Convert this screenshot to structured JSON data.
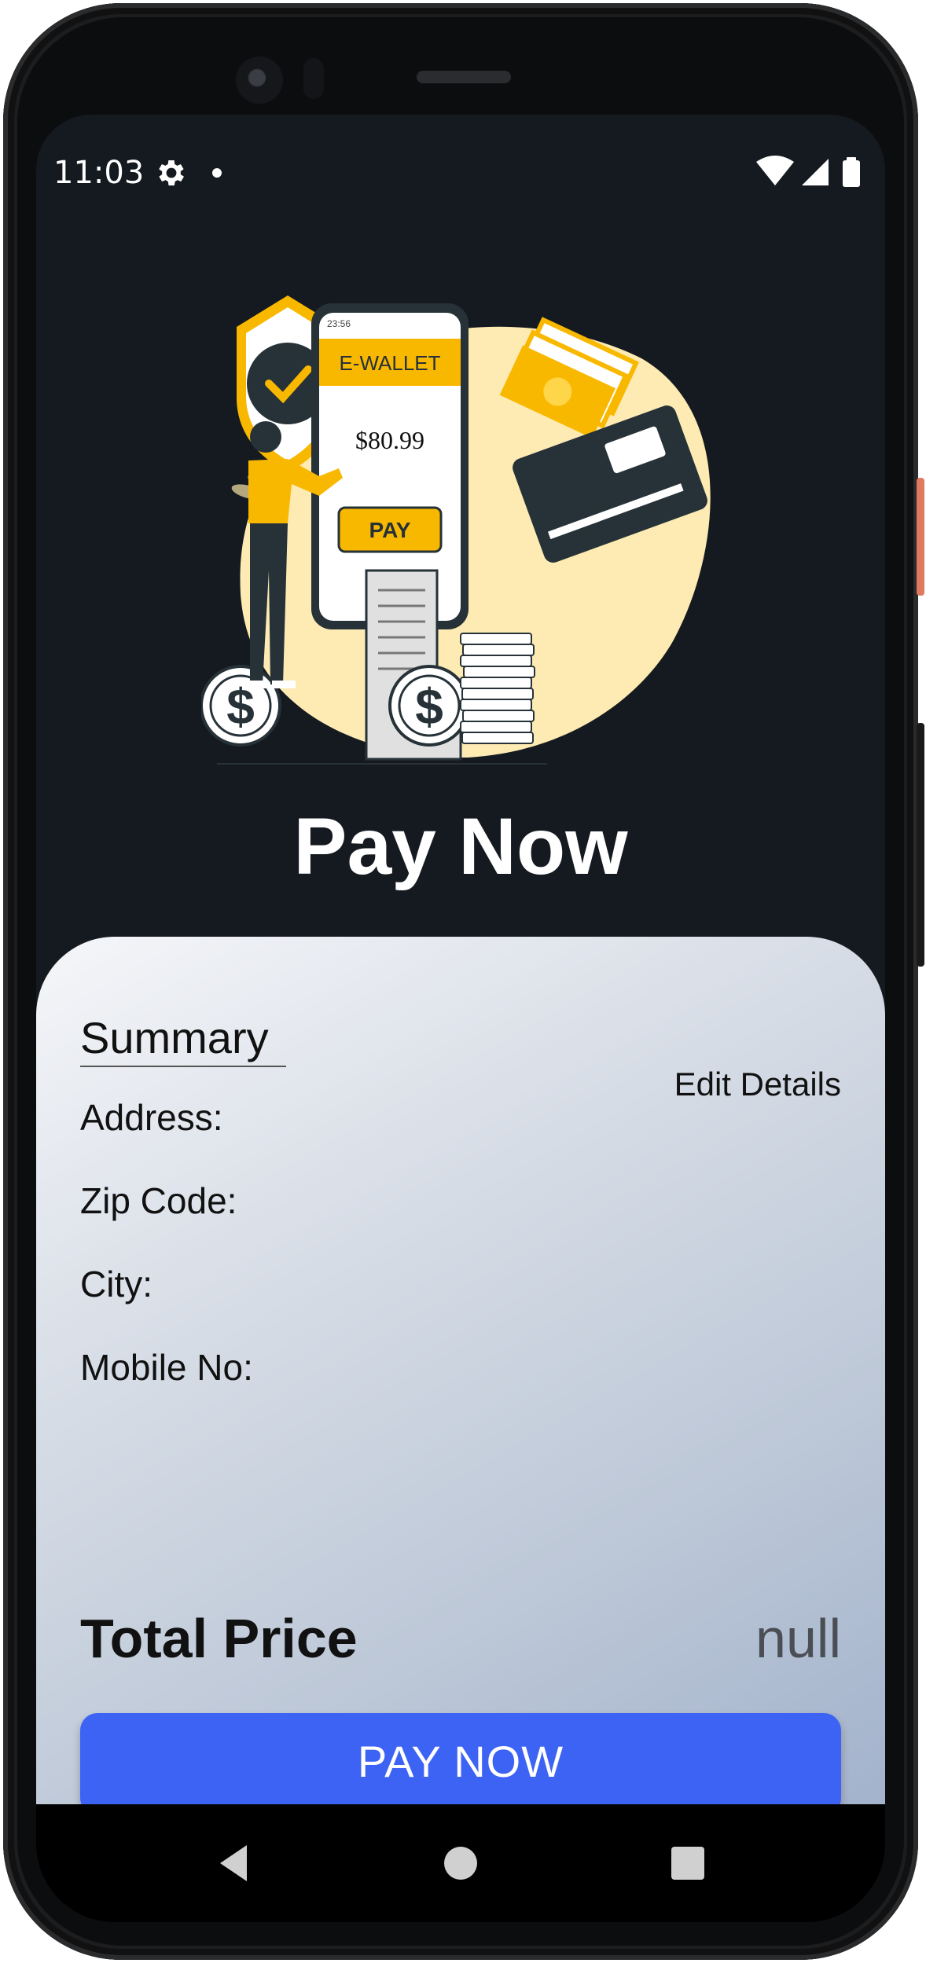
{
  "status_bar": {
    "time": "11:03",
    "icons": [
      "gear-icon",
      "notification-dot-icon",
      "wifi-icon",
      "signal-icon",
      "battery-icon"
    ]
  },
  "illustration": {
    "wallet_label": "E-WALLET",
    "amount": "$80.99",
    "pay_label": "PAY",
    "phone_time": "23:56"
  },
  "header": {
    "title": "Pay Now"
  },
  "summary": {
    "title": "Summary",
    "edit_label": "Edit Details",
    "fields": {
      "address": "Address:",
      "zip": "Zip Code:",
      "city": "City:",
      "mobile": "Mobile No:"
    },
    "total_label": "Total Price",
    "total_value": "null",
    "pay_button": "PAY NOW"
  },
  "navigation": {
    "buttons": [
      "back-icon",
      "home-icon",
      "recents-icon"
    ]
  },
  "colors": {
    "screen_bg": "#151a20",
    "accent_blue": "#3d63f5",
    "illustration_yellow": "#f9b800",
    "card_gradient_start": "#f5f6f9",
    "card_gradient_end": "#a3b3cc"
  }
}
